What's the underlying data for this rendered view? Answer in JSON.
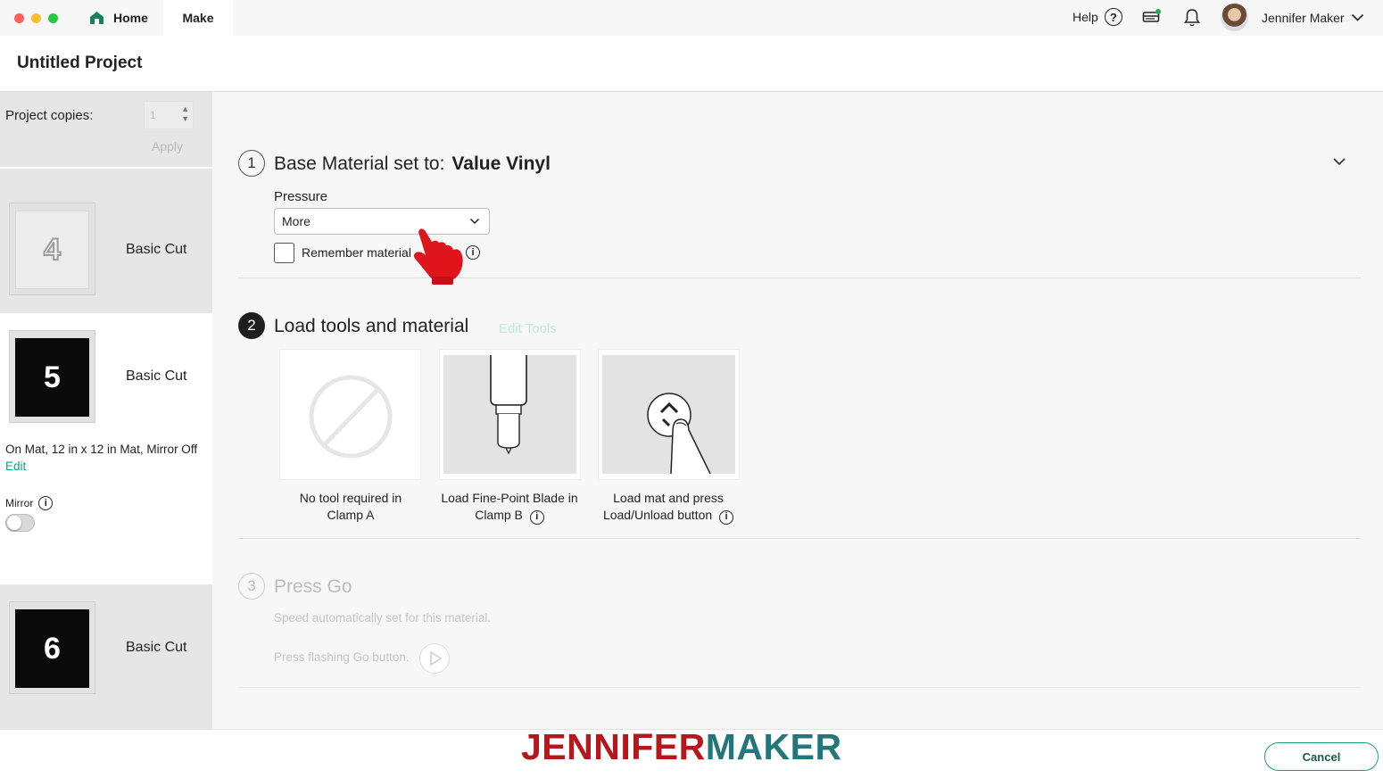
{
  "topbar": {
    "home_label": "Home",
    "make_label": "Make",
    "help_label": "Help",
    "help_icon": "?",
    "user_name": "Jennifer Maker"
  },
  "project": {
    "title": "Untitled Project"
  },
  "sidebar": {
    "copies_label": "Project copies:",
    "copies_value": "1",
    "apply_label": "Apply",
    "mats": [
      {
        "number": "4",
        "label": "Basic Cut"
      },
      {
        "number": "5",
        "label": "Basic Cut"
      },
      {
        "number": "6",
        "label": "Basic Cut"
      }
    ],
    "mat_info": "On Mat, 12 in x 12 in Mat, Mirror Off",
    "edit_label": "Edit",
    "mirror_label": "Mirror",
    "info_glyph": "i"
  },
  "step1": {
    "number": "1",
    "title": "Base Material set to:",
    "material": "Value Vinyl",
    "pressure_label": "Pressure",
    "pressure_value": "More",
    "remember_label": "Remember material"
  },
  "step2": {
    "number": "2",
    "title": "Load tools and material",
    "edit_tools_label": "Edit Tools",
    "tools": [
      {
        "line1": "No tool required in",
        "line2": "Clamp A"
      },
      {
        "line1": "Load Fine-Point Blade in",
        "line2": "Clamp B"
      },
      {
        "line1": "Load mat and press",
        "line2": "Load/Unload button"
      }
    ]
  },
  "step3": {
    "number": "3",
    "title": "Press Go",
    "speed_text": "Speed automatically set for this material.",
    "go_text": "Press flashing Go button."
  },
  "footer": {
    "brand_part1": "JENNIFER",
    "brand_part2": "MAKER",
    "cancel_label": "Cancel"
  },
  "colors": {
    "accent_green": "#17a07a",
    "brand_red": "#b5171c",
    "brand_teal": "#23777a",
    "cursor_red": "#e0141b"
  }
}
